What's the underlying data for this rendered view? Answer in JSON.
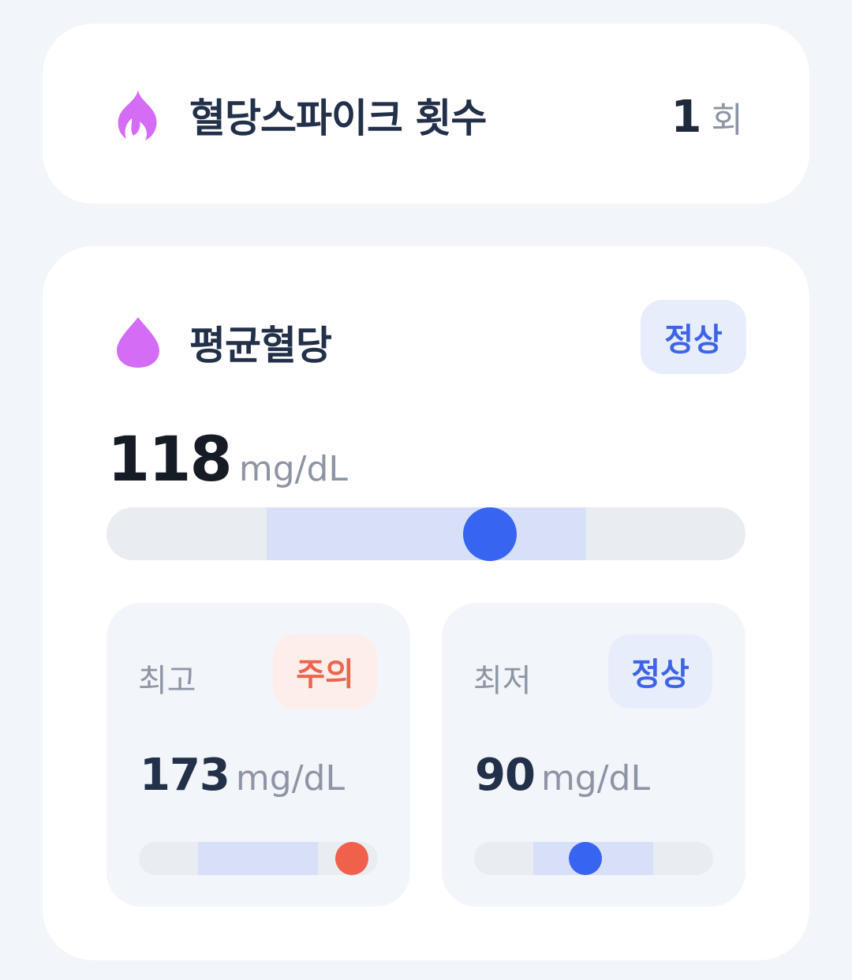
{
  "spike": {
    "icon": "flame-icon",
    "title": "혈당스파이크 횟수",
    "count": "1",
    "unit": "회"
  },
  "average": {
    "icon": "drop-icon",
    "title": "평균혈당",
    "status": "정상",
    "value": "118",
    "unit": "mg/dL",
    "gauge_level": 0.6
  },
  "highest": {
    "label": "최고",
    "status": "주의",
    "value": "173",
    "unit": "mg/dL",
    "gauge_level": 0.89
  },
  "lowest": {
    "label": "최저",
    "status": "정상",
    "value": "90",
    "unit": "mg/dL",
    "gauge_level": 0.465
  },
  "colors": {
    "accent_purple": "#d56cf5",
    "normal_blue": "#3764f0",
    "caution_red": "#f0604a"
  }
}
